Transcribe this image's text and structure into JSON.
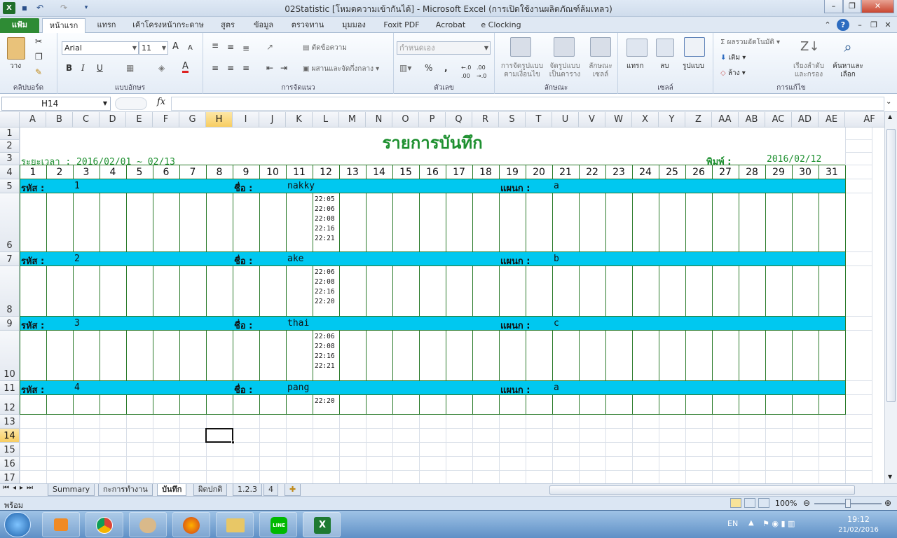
{
  "window": {
    "title": "02Statistic  [โหมดความเข้ากันได้] - Microsoft Excel (การเปิดใช้งานผลิตภัณฑ์ล้มเหลว)"
  },
  "tabs": [
    "แฟ้ม",
    "หน้าแรก",
    "แทรก",
    "เค้าโครงหน้ากระดาษ",
    "สูตร",
    "ข้อมูล",
    "ตรวจทาน",
    "มุมมอง",
    "Foxit PDF",
    "Acrobat",
    "e Clocking"
  ],
  "ribbon": {
    "clipboard": {
      "paste": "วาง",
      "group": "คลิปบอร์ด"
    },
    "font": {
      "name": "Arial",
      "size": "11",
      "bold": "B",
      "italic": "I",
      "underline": "U",
      "group": "แบบอักษร"
    },
    "alignment": {
      "wrap": "ตัดข้อความ",
      "merge": "ผสานและจัดกึ่งกลาง",
      "group": "การจัดแนว"
    },
    "number": {
      "format": "กำหนดเอง",
      "percent": "%",
      "comma": ",",
      "group": "ตัวเลข"
    },
    "styles": {
      "cond": "การจัดรูปแบบ\nตามเงื่อนไข",
      "table": "จัดรูปแบบ\nเป็นตาราง",
      "cell": "ลักษณะ\nเซลล์",
      "group": "ลักษณะ"
    },
    "cells": {
      "insert": "แทรก",
      "delete": "ลบ",
      "format": "รูปแบบ",
      "group": "เซลล์"
    },
    "editing": {
      "autosum": "ผลรวมอัตโนมัติ",
      "fill": "เติม",
      "clear": "ล้าง",
      "sort": "เรียงลำดับ\nและกรอง",
      "find": "ค้นหาและ\nเลือก",
      "group": "การแก้ไข"
    }
  },
  "formula_bar": {
    "name_box": "H14",
    "fx": "fx",
    "value": ""
  },
  "columns": [
    "A",
    "B",
    "C",
    "D",
    "E",
    "F",
    "G",
    "H",
    "I",
    "J",
    "K",
    "L",
    "M",
    "N",
    "O",
    "P",
    "Q",
    "R",
    "S",
    "T",
    "U",
    "V",
    "W",
    "X",
    "Y",
    "Z",
    "AA",
    "AB",
    "AC",
    "AD",
    "AE",
    "AF"
  ],
  "rows": [
    "1",
    "2",
    "3",
    "4",
    "5",
    "6",
    "7",
    "8",
    "9",
    "10",
    "11",
    "12",
    "13",
    "14",
    "15",
    "16",
    "17"
  ],
  "sheet": {
    "title": "รายการบันทึก",
    "period_label": "ระยะเวลา : 2016/02/01 ~ 02/13",
    "print_label": "พิมพ์ :",
    "print_date": "2016/02/12",
    "days": [
      "1",
      "2",
      "3",
      "4",
      "5",
      "6",
      "7",
      "8",
      "9",
      "10",
      "11",
      "12",
      "13",
      "14",
      "15",
      "16",
      "17",
      "18",
      "19",
      "20",
      "21",
      "22",
      "23",
      "24",
      "25",
      "26",
      "27",
      "28",
      "29",
      "30",
      "31"
    ],
    "id_label": "รหัส :",
    "name_label": "ชื่อ :",
    "dept_label": "แผนก :",
    "employees": [
      {
        "id": "1",
        "name": "nakky",
        "dept": "a",
        "day12": [
          "22:05",
          "22:06",
          "22:08",
          "22:16",
          "22:21"
        ]
      },
      {
        "id": "2",
        "name": "ake",
        "dept": "b",
        "day12": [
          "22:06",
          "22:08",
          "22:16",
          "22:20"
        ]
      },
      {
        "id": "3",
        "name": "thai",
        "dept": "c",
        "day12": [
          "22:06",
          "22:08",
          "22:16",
          "22:21"
        ]
      },
      {
        "id": "4",
        "name": "pang",
        "dept": "a",
        "day12": [
          "22:20"
        ]
      }
    ]
  },
  "sheet_tabs": [
    "Summary",
    "กะการทำงาน",
    "บันทึก",
    "ผิดปกติ",
    "1.2.3",
    "4"
  ],
  "status": {
    "ready": "พร้อม",
    "zoom": "100%"
  },
  "taskbar": {
    "lang": "EN",
    "time": "19:12",
    "date": "21/02/2016"
  }
}
